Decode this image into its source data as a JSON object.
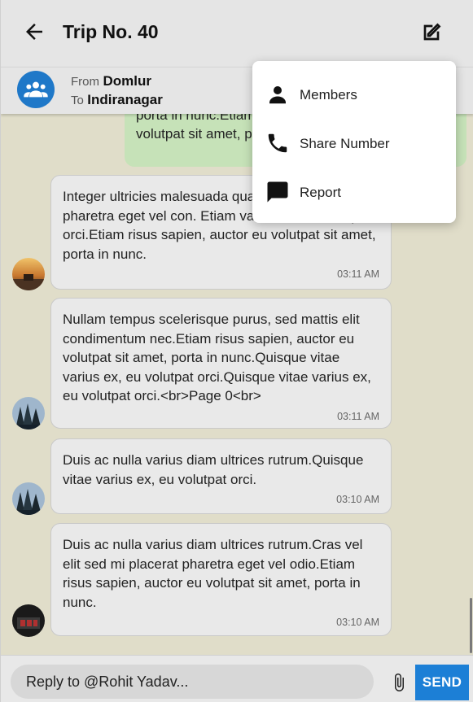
{
  "header": {
    "title": "Trip No. 40",
    "back_icon": "arrow-left-icon",
    "edit_icon": "edit-icon"
  },
  "trip": {
    "from_label": "From",
    "from_place": "Domlur",
    "to_label": "To",
    "to_place": "Indiranagar",
    "avatar_icon": "group-icon"
  },
  "sent_message": {
    "partial_text_line1": "porta in nunc.Etiam",
    "partial_text_line2": "volutpat sit amet, p"
  },
  "messages": [
    {
      "text": "Integer ultricies malesuada quam, vel mi placerat pharetra eget vel con. Etiam varius ex, eu volutpat orci.Etiam risus sapien, auctor eu volutpat sit amet, porta in nunc.",
      "time": "03:11 AM",
      "avatar": "sunset-avatar"
    },
    {
      "text": "Nullam tempus scelerisque purus, sed mattis elit condimentum nec.Etiam risus sapien, auctor eu volutpat sit amet, porta in nunc.Quisque vitae varius ex, eu volutpat orci.Quisque vitae varius ex, eu volutpat orci.<br>Page 0<br>",
      "time": "03:11 AM",
      "avatar": "forest-avatar"
    },
    {
      "text": "Duis ac nulla varius diam ultrices rutrum.Quisque vitae varius ex, eu volutpat orci.",
      "time": "03:10 AM",
      "avatar": "forest-avatar"
    },
    {
      "text": "Duis ac nulla varius diam ultrices rutrum.Cras vel elit sed mi placerat pharetra eget vel odio.Etiam risus sapien, auctor eu volutpat sit amet, porta in nunc.",
      "time": "03:10 AM",
      "avatar": "dark-avatar"
    }
  ],
  "menu": {
    "items": [
      {
        "label": "Members",
        "icon": "person-icon"
      },
      {
        "label": "Share Number",
        "icon": "phone-icon"
      },
      {
        "label": "Report",
        "icon": "report-icon"
      }
    ]
  },
  "composer": {
    "placeholder": "Reply to @Rohit Yadav...",
    "send_label": "SEND",
    "attach_icon": "paperclip-icon"
  },
  "colors": {
    "chat_background": "#e0ddc9",
    "sent_bubble": "#c6e2b8",
    "received_bubble": "#e9e9e9",
    "accent": "#1c7fd6"
  }
}
